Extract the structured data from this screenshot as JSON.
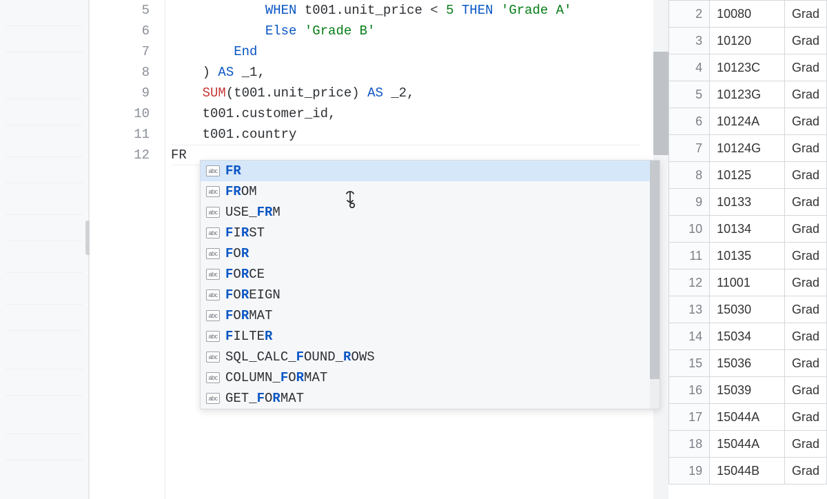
{
  "editor": {
    "lines": [
      {
        "n": 5,
        "tokens": [
          {
            "t": "            "
          },
          {
            "t": "WHEN",
            "c": "kw-blue"
          },
          {
            "t": " t001.unit_price "
          },
          {
            "t": "<",
            "c": "op"
          },
          {
            "t": " "
          },
          {
            "t": "5",
            "c": "num-lit"
          },
          {
            "t": " "
          },
          {
            "t": "THEN",
            "c": "kw-blue"
          },
          {
            "t": " "
          },
          {
            "t": "'Grade A'",
            "c": "lit-str"
          }
        ]
      },
      {
        "n": 6,
        "tokens": [
          {
            "t": "            "
          },
          {
            "t": "Else",
            "c": "kw-else"
          },
          {
            "t": " "
          },
          {
            "t": "'Grade B'",
            "c": "lit-str"
          }
        ]
      },
      {
        "n": 7,
        "tokens": [
          {
            "t": "        "
          },
          {
            "t": "End",
            "c": "kw-blue"
          }
        ]
      },
      {
        "n": 8,
        "tokens": [
          {
            "t": "    ) "
          },
          {
            "t": "AS",
            "c": "kw-blue"
          },
          {
            "t": " _1,"
          }
        ]
      },
      {
        "n": 9,
        "tokens": [
          {
            "t": "    "
          },
          {
            "t": "SUM",
            "c": "kw-func"
          },
          {
            "t": "(t001.unit_price) "
          },
          {
            "t": "AS",
            "c": "kw-blue"
          },
          {
            "t": " _2,"
          }
        ]
      },
      {
        "n": 10,
        "tokens": [
          {
            "t": "    t001.customer_id,"
          }
        ]
      },
      {
        "n": 11,
        "tokens": [
          {
            "t": "    t001.country"
          }
        ]
      },
      {
        "n": 12,
        "tokens": [
          {
            "t": "FR"
          }
        ],
        "current": true
      }
    ],
    "typed": "FR"
  },
  "autocomplete": {
    "icon_label": "abc",
    "items": [
      {
        "parts": [
          {
            "t": "FR",
            "b": true
          }
        ],
        "selected": true
      },
      {
        "parts": [
          {
            "t": "FR",
            "b": true
          },
          {
            "t": "OM"
          }
        ]
      },
      {
        "parts": [
          {
            "t": "USE_"
          },
          {
            "t": "FR",
            "b": true
          },
          {
            "t": "M"
          }
        ]
      },
      {
        "parts": [
          {
            "t": "F",
            "b": true
          },
          {
            "t": "I"
          },
          {
            "t": "R",
            "b": true
          },
          {
            "t": "ST"
          }
        ]
      },
      {
        "parts": [
          {
            "t": "F",
            "b": true
          },
          {
            "t": "O"
          },
          {
            "t": "R",
            "b": true
          }
        ]
      },
      {
        "parts": [
          {
            "t": "F",
            "b": true
          },
          {
            "t": "O"
          },
          {
            "t": "R",
            "b": true
          },
          {
            "t": "CE"
          }
        ]
      },
      {
        "parts": [
          {
            "t": "F",
            "b": true
          },
          {
            "t": "O"
          },
          {
            "t": "R",
            "b": true
          },
          {
            "t": "EIGN"
          }
        ]
      },
      {
        "parts": [
          {
            "t": "F",
            "b": true
          },
          {
            "t": "O"
          },
          {
            "t": "R",
            "b": true
          },
          {
            "t": "MAT"
          }
        ]
      },
      {
        "parts": [
          {
            "t": "F",
            "b": true
          },
          {
            "t": "ILTE"
          },
          {
            "t": "R",
            "b": true
          }
        ]
      },
      {
        "parts": [
          {
            "t": "SQL_CALC_"
          },
          {
            "t": "F",
            "b": true
          },
          {
            "t": "OUND_"
          },
          {
            "t": "R",
            "b": true
          },
          {
            "t": "OWS"
          }
        ]
      },
      {
        "parts": [
          {
            "t": "COLUMN_"
          },
          {
            "t": "F",
            "b": true
          },
          {
            "t": "O"
          },
          {
            "t": "R",
            "b": true
          },
          {
            "t": "MAT"
          }
        ]
      },
      {
        "parts": [
          {
            "t": "GET_"
          },
          {
            "t": "F",
            "b": true
          },
          {
            "t": "O"
          },
          {
            "t": "R",
            "b": true
          },
          {
            "t": "MAT"
          }
        ]
      }
    ]
  },
  "results": {
    "grade_prefix": "Grad",
    "rows": [
      {
        "n": 2,
        "stock": "10080"
      },
      {
        "n": 3,
        "stock": "10120"
      },
      {
        "n": 4,
        "stock": "10123C"
      },
      {
        "n": 5,
        "stock": "10123G"
      },
      {
        "n": 6,
        "stock": "10124A"
      },
      {
        "n": 7,
        "stock": "10124G"
      },
      {
        "n": 8,
        "stock": "10125"
      },
      {
        "n": 9,
        "stock": "10133"
      },
      {
        "n": 10,
        "stock": "10134"
      },
      {
        "n": 11,
        "stock": "10135"
      },
      {
        "n": 12,
        "stock": "11001"
      },
      {
        "n": 13,
        "stock": "15030"
      },
      {
        "n": 14,
        "stock": "15034"
      },
      {
        "n": 15,
        "stock": "15036"
      },
      {
        "n": 16,
        "stock": "15039"
      },
      {
        "n": 17,
        "stock": "15044A"
      },
      {
        "n": 18,
        "stock": "15044A"
      },
      {
        "n": 19,
        "stock": "15044B"
      }
    ]
  }
}
